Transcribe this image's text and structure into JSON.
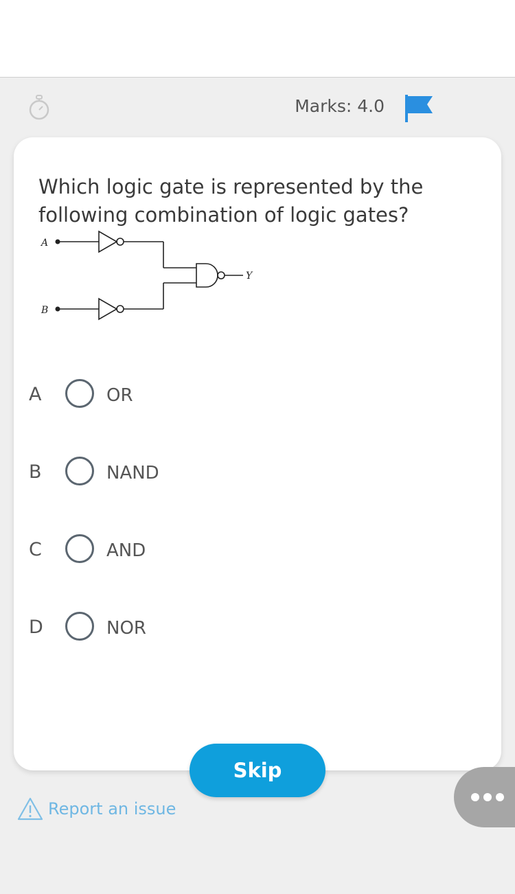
{
  "header": {
    "marks_label": "Marks: 4.0",
    "timer_icon": "stopwatch-icon",
    "flag_icon": "flag-icon",
    "flag_color": "#2a8fe0"
  },
  "question": {
    "text": "Which logic gate is represented by the following combination of logic gates?",
    "circuit": {
      "input_a": "A",
      "input_b": "B",
      "output": "Y"
    }
  },
  "options": [
    {
      "letter": "A",
      "text": "OR"
    },
    {
      "letter": "B",
      "text": "NAND"
    },
    {
      "letter": "C",
      "text": "AND"
    },
    {
      "letter": "D",
      "text": "NOR"
    }
  ],
  "footer": {
    "skip_label": "Skip",
    "report_label": "Report an issue",
    "accent_color": "#0f9fdc",
    "more_icon": "more-dots-icon"
  }
}
